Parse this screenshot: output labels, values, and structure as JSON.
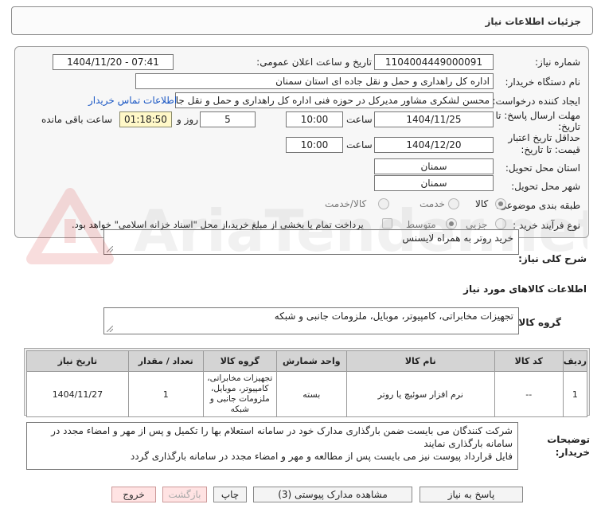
{
  "header": {
    "title": "جزئیات اطلاعات نیاز"
  },
  "form": {
    "need_number_label": "شماره نیاز:",
    "need_number": "1104004449000091",
    "announce_label": "تاریخ و ساعت اعلان عمومی:",
    "announce_value": "1404/11/20 - 07:41",
    "buyer_org_label": "نام دستگاه خریدار:",
    "buyer_org": "اداره کل راهداری و حمل و نقل جاده ای استان سمنان",
    "creator_label": "ایجاد کننده درخواست:",
    "creator": "محسن لشکری مشاور مدیرکل در حوزه فنی اداره کل راهداری و حمل و نقل جاده",
    "contact_link": "اطلاعات تماس خریدار",
    "deadline_label_1": "مهلت ارسال پاسخ: تا",
    "deadline_label_2": "تاریخ:",
    "deadline_date": "1404/11/25",
    "time_label": "ساعت",
    "deadline_time": "10:00",
    "days": "5",
    "days_label": "روز و",
    "remaining_time": "01:18:50",
    "remaining_label": "ساعت باقی مانده",
    "validity_label_1": "حداقل تاریخ اعتبار",
    "validity_label_2": "قیمت: تا تاریخ:",
    "validity_date": "1404/12/20",
    "validity_time": "10:00",
    "province_label": "استان محل تحویل:",
    "province": "سمنان",
    "city_label": "شهر محل تحویل:",
    "city": "سمنان",
    "category_label": "طبقه بندی موضوعی:",
    "category_options": [
      "کالا",
      "خدمت",
      "کالا/خدمت"
    ],
    "process_label": "نوع فرآیند خرید :",
    "process_options": [
      "جزیی",
      "متوسط"
    ],
    "payment_note": "پرداخت تمام یا بخشی از مبلغ خرید،از محل \"اسناد خزانه اسلامی\" خواهد بود."
  },
  "summary": {
    "label": "شرح کلی نیاز:",
    "value": "خرید روتر به همراه لایسنس"
  },
  "goods_info": {
    "title": "اطلاعات کالاهای مورد نیاز",
    "group_label": "گروه کالا:",
    "group_value": "تجهیزات مخابراتی، کامپیوتر، موبایل، ملزومات جانبی و شبکه"
  },
  "table": {
    "headers": [
      "ردیف",
      "کد کالا",
      "نام کالا",
      "واحد شمارش",
      "گروه کالا",
      "تعداد / مقدار",
      "تاریخ نیاز"
    ],
    "rows": [
      {
        "index": "1",
        "code": "--",
        "name": "نرم افزار سوئیچ یا روتر",
        "unit": "بسته",
        "group": "تجهیزات مخابراتی، کامپیوتر، موبایل، ملزومات جانبی و شبکه",
        "qty": "1",
        "date": "1404/11/27"
      }
    ]
  },
  "notes": {
    "label_1": "توضیحات",
    "label_2": "خریدار:",
    "line1": "شرکت کنندگان می بایست ضمن بارگذاری مدارک خود در سامانه استعلام بها را تکمیل و پس از مهر و امضاء مجدد در سامانه بارگذاری نمایند",
    "line2": "فایل قرارداد پیوست نیز می بایست پس از مطالعه و مهر و امضاء مجدد در سامانه بارگذاری گردد"
  },
  "buttons": {
    "reply": "پاسخ به نیاز",
    "attachments": "مشاهده مدارک پیوستی (3)",
    "print": "چاپ",
    "back": "بازگشت",
    "exit": "خروج"
  },
  "watermark": {
    "text": "AriaTender.net"
  },
  "colors": {
    "link": "#1a57c4",
    "time_box": "#fff8c8",
    "table_header": "#d4d4d4",
    "exit_button": "#ffe3e3"
  }
}
